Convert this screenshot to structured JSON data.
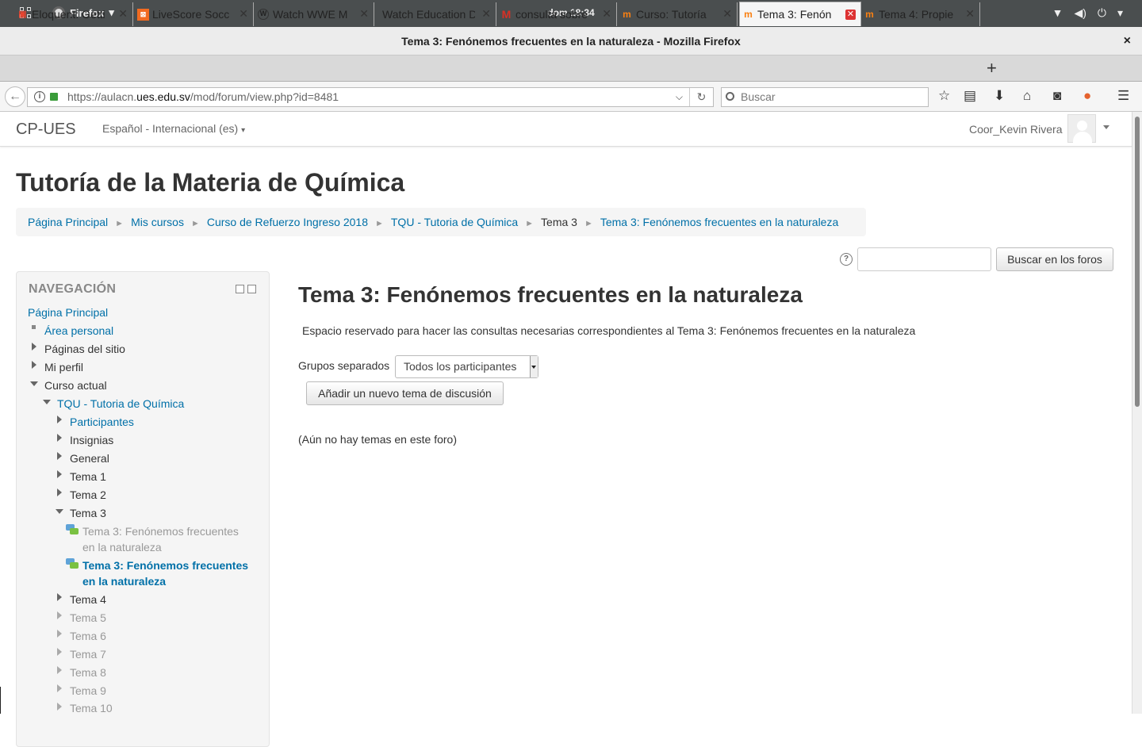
{
  "system": {
    "app_menu": "Firefox",
    "clock": "dom 18:34"
  },
  "window": {
    "title": "Tema 3: Fenónemos frecuentes en la naturaleza - Mozilla Firefox",
    "close": "×"
  },
  "tabs": [
    {
      "label": "Eloquent: Getti",
      "icon": "laravel-icon",
      "color": "#e74430"
    },
    {
      "label": "LiveScore Socc",
      "icon": "livescore-icon",
      "color": "#f26b21"
    },
    {
      "label": "Watch WWE M",
      "icon": "wordpress-icon",
      "color": "#333333"
    },
    {
      "label": "Watch Education D",
      "icon": "",
      "color": ""
    },
    {
      "label": "consulta sobre",
      "icon": "gmail-icon",
      "color": "#d93025"
    },
    {
      "label": "Curso: Tutoría",
      "icon": "moodle-icon",
      "color": "#f98012"
    },
    {
      "label": "Tema 3: Fenón",
      "icon": "moodle-icon",
      "color": "#f98012",
      "active": true
    },
    {
      "label": "Tema 4: Propie",
      "icon": "moodle-icon",
      "color": "#f98012"
    }
  ],
  "browser": {
    "url_prefix": "https://aulacn.",
    "url_domain": "ues.edu.sv",
    "url_path": "/mod/forum/view.php?id=8481",
    "search_placeholder": "Buscar"
  },
  "site": {
    "brand": "CP-UES",
    "language": "Español - Internacional (es)",
    "user": "Coor_Kevin Rivera"
  },
  "course_title": "Tutoría de la Materia de Química",
  "breadcrumb": [
    "Página Principal",
    "Mis cursos",
    "Curso de Refuerzo Ingreso 2018",
    "TQU - Tutoria de Química",
    "Tema 3",
    "Tema 3: Fenónemos frecuentes en la naturaleza"
  ],
  "forum_search": {
    "button": "Buscar en los foros",
    "help": "?"
  },
  "navigation": {
    "heading": "NAVEGACIÓN",
    "items": [
      "Página Principal",
      "Área personal",
      "Páginas del sitio",
      "Mi perfil",
      "Curso actual",
      "TQU - Tutoria de Química",
      "Participantes",
      "Insignias",
      "General",
      "Tema 1",
      "Tema 2",
      "Tema 3",
      "Tema 3: Fenónemos frecuentes",
      "en la naturaleza",
      "Tema 3: Fenónemos frecuentes",
      "en la naturaleza",
      "Tema 4",
      "Tema 5",
      "Tema 6",
      "Tema 7",
      "Tema 8",
      "Tema 9",
      "Tema 10"
    ]
  },
  "main": {
    "title": "Tema 3: Fenónemos frecuentes en la naturaleza",
    "intro": "Espacio reservado para hacer las consultas necesarias correspondientes al Tema 3: Fenónemos frecuentes en la naturaleza",
    "groups_label": "Grupos separados",
    "groups_value": "Todos los participantes",
    "add_button": "Añadir un nuevo tema de discusión",
    "empty": "(Aún no hay temas en este foro)"
  }
}
